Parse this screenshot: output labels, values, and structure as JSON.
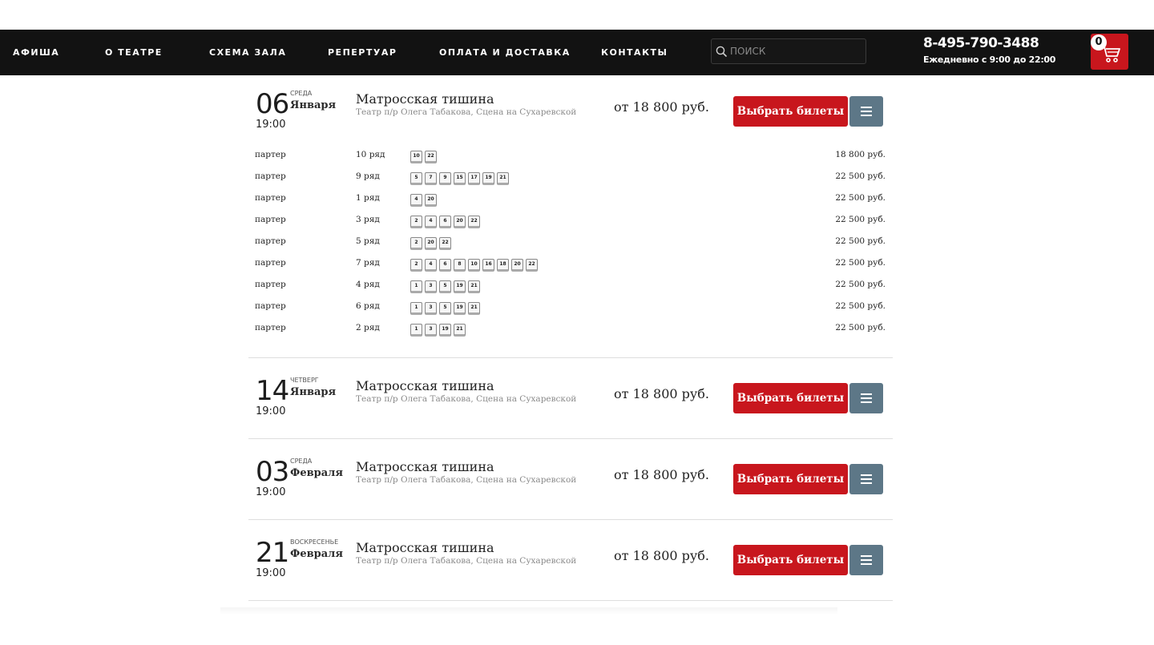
{
  "nav": {
    "items": [
      "АФИША",
      "О ТЕАТРЕ",
      "СХЕМА ЗАЛА",
      "РЕПЕРТУАР",
      "ОПЛАТА И ДОСТАВКА",
      "КОНТАКТЫ"
    ],
    "search_placeholder": "ПОИСК",
    "phone": "8-495-790-3488",
    "hours": "Ежедневно с 9:00 до 22:00",
    "cart_count": "0"
  },
  "colors": {
    "nav_bg": "#121212",
    "accent": "#c8161d",
    "secondary_button": "#5d7787"
  },
  "events": [
    {
      "day": "06",
      "weekday": "СРЕДА",
      "month": "Января",
      "time": "19:00",
      "title": "Матросская тишина",
      "venue": "Театр п/р Олега Табакова, Сцена на Сухаревской",
      "price": "от 18 800 руб.",
      "buy_label": "Выбрать билеты",
      "menu_icon": "menu-icon"
    },
    {
      "day": "14",
      "weekday": "ЧЕТВЕРГ",
      "month": "Января",
      "time": "19:00",
      "title": "Матросская тишина",
      "venue": "Театр п/р Олега Табакова, Сцена на Сухаревской",
      "price": "от 18 800 руб.",
      "buy_label": "Выбрать билеты",
      "menu_icon": "menu-icon"
    },
    {
      "day": "03",
      "weekday": "СРЕДА",
      "month": "Февраля",
      "time": "19:00",
      "title": "Матросская тишина",
      "venue": "Театр п/р Олега Табакова, Сцена на Сухаревской",
      "price": "от 18 800 руб.",
      "buy_label": "Выбрать билеты",
      "menu_icon": "menu-icon"
    },
    {
      "day": "21",
      "weekday": "ВОСКРЕСЕНЬЕ",
      "month": "Февраля",
      "time": "19:00",
      "title": "Матросская тишина",
      "venue": "Театр п/р Олега Табакова, Сцена на Сухаревской",
      "price": "от 18 800 руб.",
      "buy_label": "Выбрать билеты",
      "menu_icon": "menu-icon"
    }
  ],
  "seat_rows": [
    {
      "zone": "партер",
      "row": "10 ряд",
      "seats": [
        "10",
        "22"
      ],
      "price": "18 800 руб."
    },
    {
      "zone": "партер",
      "row": "9 ряд",
      "seats": [
        "5",
        "7",
        "9",
        "15",
        "17",
        "19",
        "21"
      ],
      "price": "22 500 руб."
    },
    {
      "zone": "партер",
      "row": "1 ряд",
      "seats": [
        "4",
        "20"
      ],
      "price": "22 500 руб."
    },
    {
      "zone": "партер",
      "row": "3 ряд",
      "seats": [
        "2",
        "4",
        "6",
        "20",
        "22"
      ],
      "price": "22 500 руб."
    },
    {
      "zone": "партер",
      "row": "5 ряд",
      "seats": [
        "2",
        "20",
        "22"
      ],
      "price": "22 500 руб."
    },
    {
      "zone": "партер",
      "row": "7 ряд",
      "seats": [
        "2",
        "4",
        "6",
        "8",
        "10",
        "16",
        "18",
        "20",
        "22"
      ],
      "price": "22 500 руб."
    },
    {
      "zone": "партер",
      "row": "4 ряд",
      "seats": [
        "1",
        "3",
        "5",
        "19",
        "21"
      ],
      "price": "22 500 руб."
    },
    {
      "zone": "партер",
      "row": "6 ряд",
      "seats": [
        "1",
        "3",
        "5",
        "19",
        "21"
      ],
      "price": "22 500 руб."
    },
    {
      "zone": "партер",
      "row": "2 ряд",
      "seats": [
        "1",
        "3",
        "19",
        "21"
      ],
      "price": "22 500 руб."
    }
  ]
}
